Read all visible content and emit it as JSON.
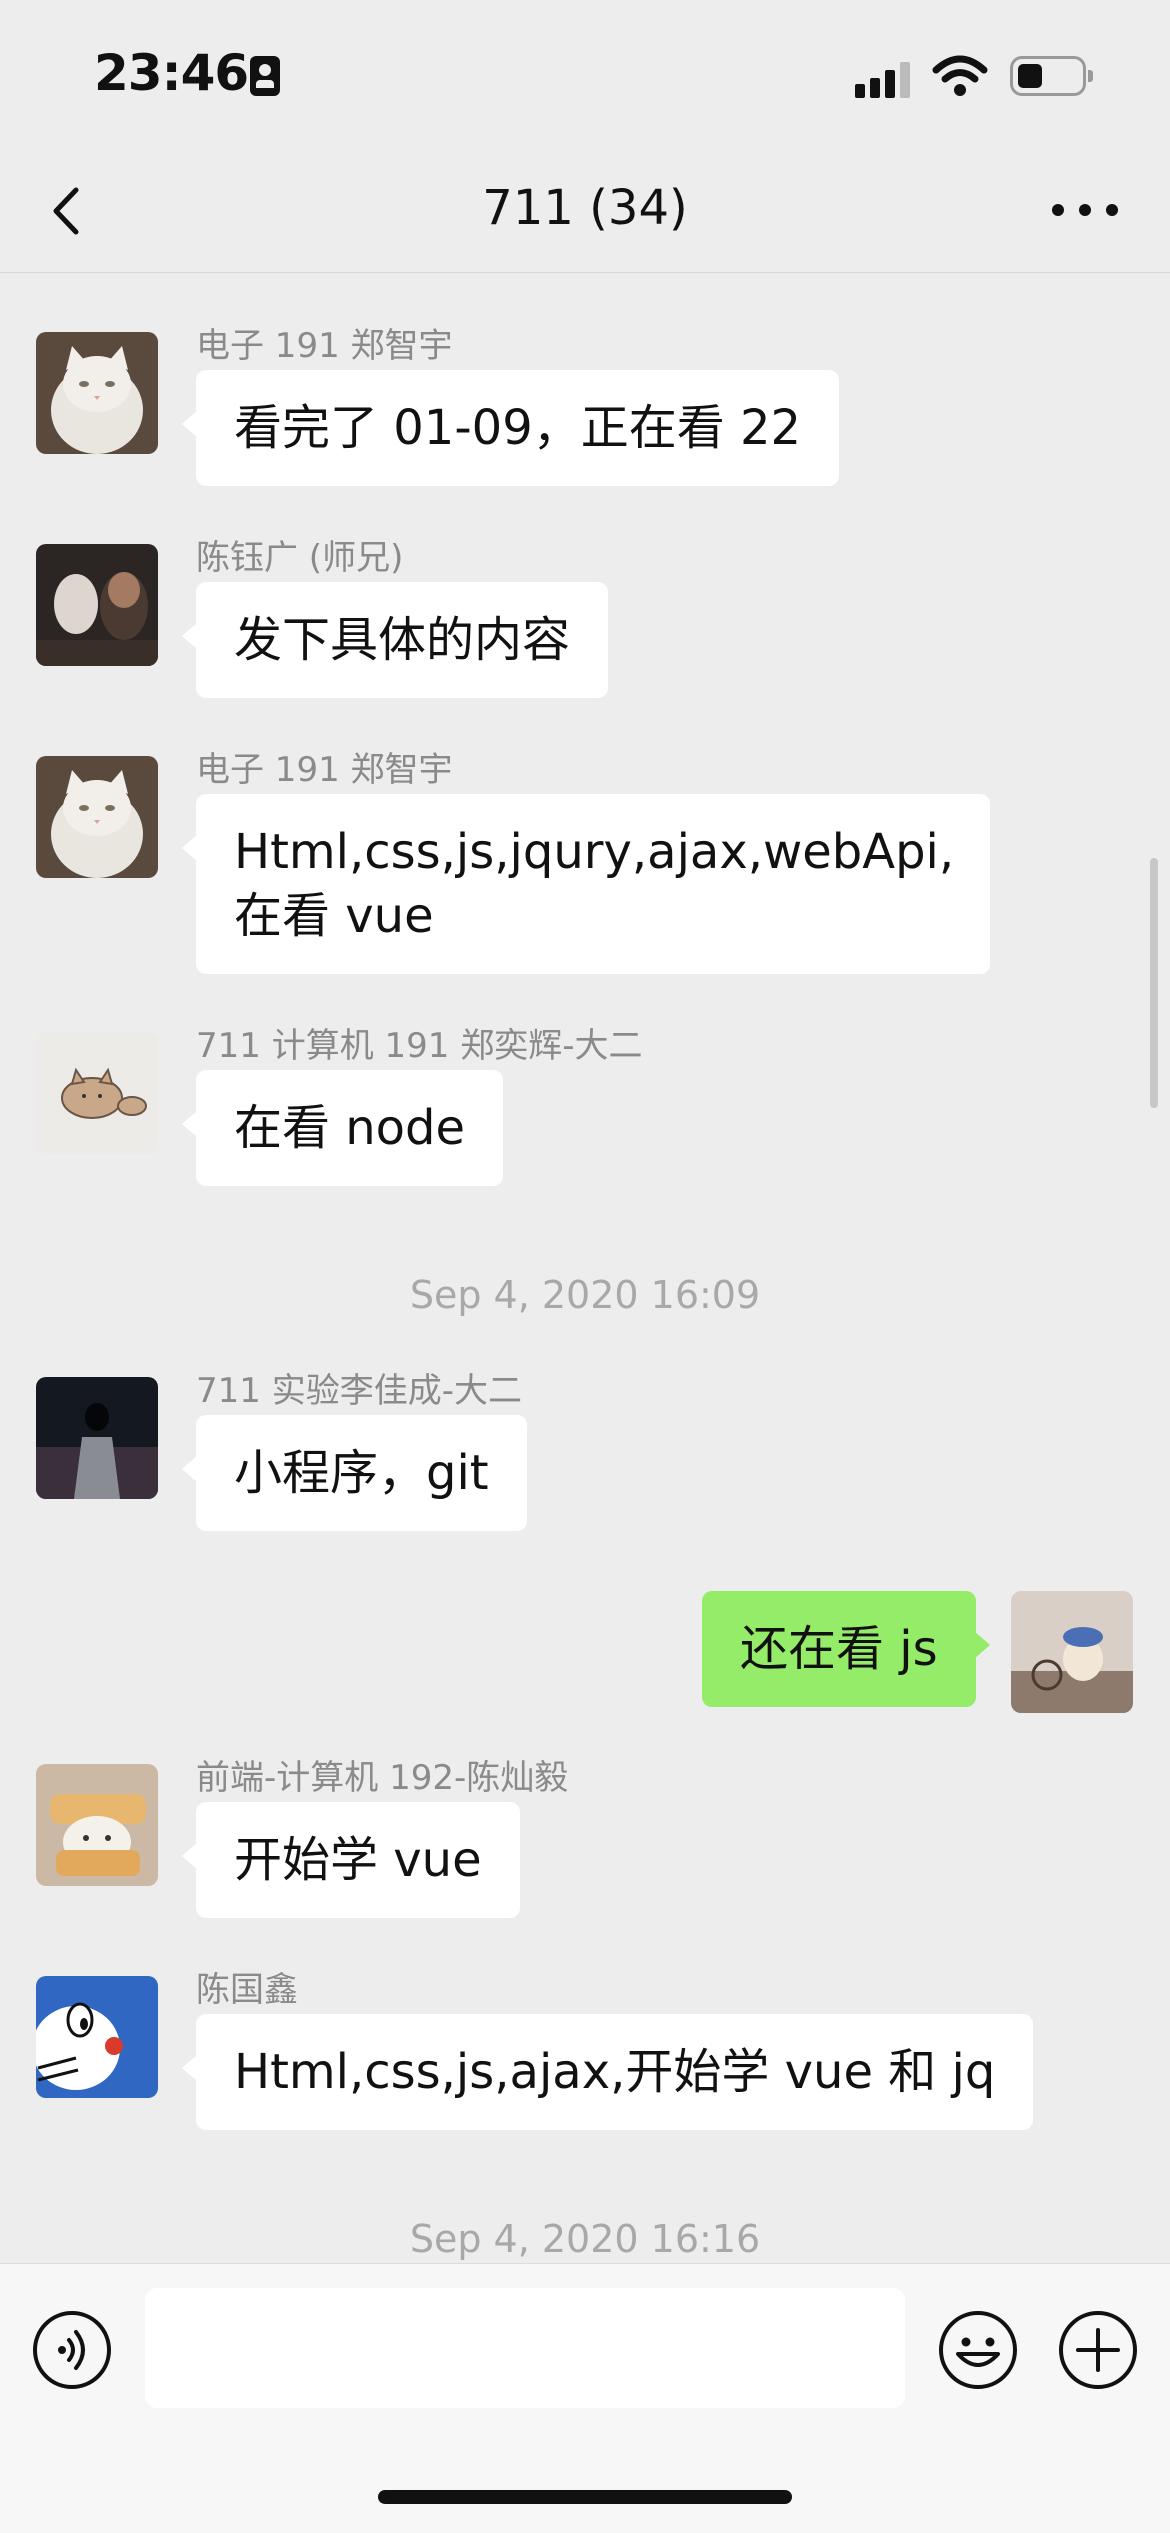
{
  "status_bar": {
    "time": "23:46"
  },
  "nav": {
    "title": "711 (34)"
  },
  "messages": [
    {
      "sender": "电子 191 郑智宇",
      "text": "看完了 01-09，正在看 22"
    },
    {
      "sender": "陈钰广 (师兄)",
      "text": "发下具体的内容"
    },
    {
      "sender": "电子 191 郑智宇",
      "text": "Html,css,js,jqury,ajax,webApi,在看 vue"
    },
    {
      "sender": "711 计算机 191 郑奕辉-大二",
      "text": "在看 node"
    },
    {
      "sender": "711 实验李佳成-大二",
      "text": "小程序，git"
    },
    {
      "text": "还在看 js"
    },
    {
      "sender": "前端-计算机 192-陈灿毅",
      "text": "开始学 vue"
    },
    {
      "sender": "陈国鑫",
      "text": "Html,css,js,ajax,开始学 vue 和 jq"
    }
  ],
  "timestamps": [
    "Sep 4, 2020 16:09",
    "Sep 4, 2020 16:16"
  ],
  "colors": {
    "background": "#ededed",
    "own_bubble": "#95ec69",
    "other_bubble": "#ffffff",
    "sender_text": "#8a8a8a",
    "timestamp_text": "#a8a8a8"
  },
  "icons": {
    "back": "chevron-left-icon",
    "more": "ellipsis-icon",
    "voice": "voice-icon",
    "emoji": "emoji-icon",
    "plus": "plus-icon"
  }
}
